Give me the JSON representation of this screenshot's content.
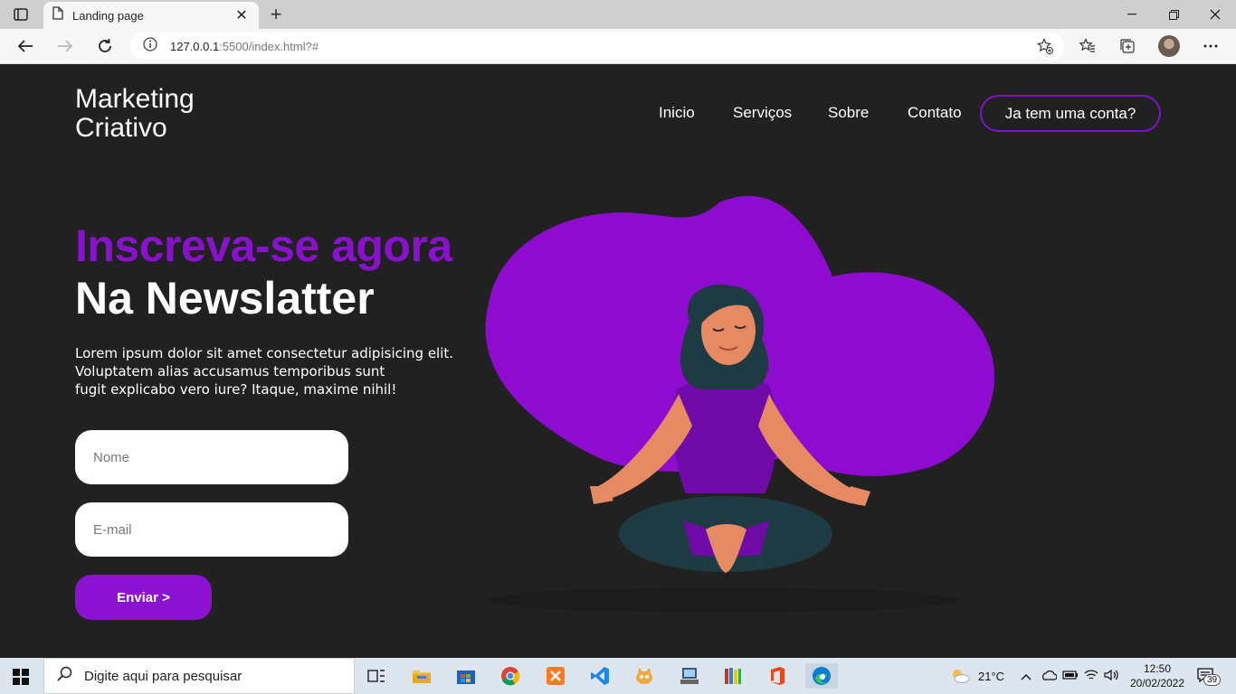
{
  "browser": {
    "tab_title": "Landing page",
    "url_host": "127.0.0.1",
    "url_rest": ":5500/index.html?#"
  },
  "site": {
    "logo_line1": "Marketing",
    "logo_line2": "Criativo",
    "nav": [
      "Inicio",
      "Serviços",
      "Sobre",
      "Contato"
    ],
    "account_button": "Ja tem uma conta?",
    "headline1": "Inscreva-se agora",
    "headline2": "Na Newslatter",
    "body_lines": [
      "Lorem ipsum dolor sit amet consectetur adipisicing elit.",
      "Voluptatem alias accusamus temporibus sunt",
      "fugit explicabo vero iure? Itaque, maxime nihil!"
    ],
    "name_placeholder": "Nome",
    "email_placeholder": "E-mail",
    "submit_label": "Enviar >"
  },
  "taskbar": {
    "search_placeholder": "Digite aqui para pesquisar",
    "weather": "21°C",
    "time": "12:50",
    "date": "20/02/2022",
    "notifications": "39"
  },
  "colors": {
    "accent": "#8811cc",
    "background": "#212121"
  }
}
